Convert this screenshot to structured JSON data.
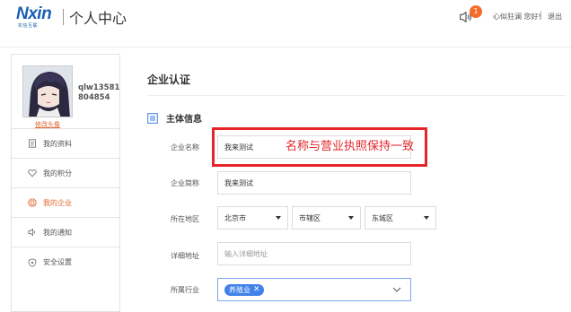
{
  "header": {
    "logo_text": "Nxin",
    "logo_subtext": "农信互联",
    "page_title": "个人中心",
    "notification_count": "1",
    "greeting": "心似狂澜 您好!",
    "logout_label": "退出"
  },
  "sidebar": {
    "username": "qlw13581804854",
    "edit_avatar_label": "修改头像",
    "items": [
      {
        "label": "我的资料",
        "icon": "document-icon",
        "active": false
      },
      {
        "label": "我的积分",
        "icon": "heart-icon",
        "active": false
      },
      {
        "label": "我的企业",
        "icon": "building-icon",
        "active": true
      },
      {
        "label": "我的通知",
        "icon": "speaker-icon",
        "active": false
      },
      {
        "label": "安全设置",
        "icon": "shield-icon",
        "active": false
      }
    ]
  },
  "main": {
    "title": "企业认证",
    "section_title": "主体信息",
    "form": {
      "company_name_label": "企业名称",
      "company_name_value": "我来测试",
      "company_short_label": "企业简称",
      "company_short_value": "我来测试",
      "region_label": "所在地区",
      "province": "北京市",
      "city": "市辖区",
      "district": "东城区",
      "address_label": "详细地址",
      "address_placeholder": "输入详细地址",
      "industry_label": "所属行业",
      "industry_tag": "养殖业"
    }
  },
  "annotation": {
    "text": "名称与营业执照保持一致",
    "color": "#e5252a"
  },
  "colors": {
    "accent_orange": "#e0672e",
    "brand_blue": "#1a5fb4",
    "tag_blue": "#3f82ea",
    "badge_orange": "#f46b2a"
  }
}
